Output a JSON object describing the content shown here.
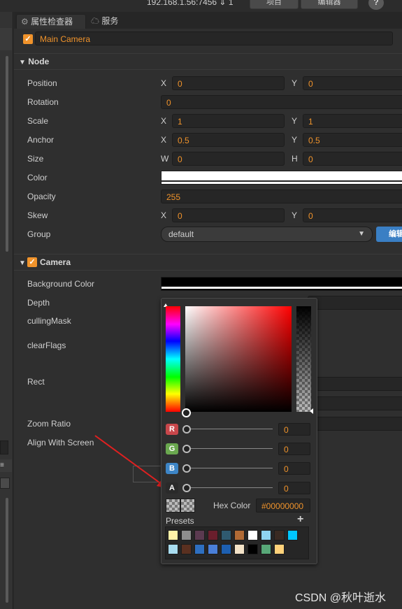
{
  "topbar": {
    "ip": "192.168.1.56:7456 ⇓ 1",
    "btn1": "项目",
    "btn2": "编辑器",
    "help": "?"
  },
  "tabs": [
    {
      "label": "属性检查器"
    },
    {
      "label": "服务"
    }
  ],
  "node_name": "Main Camera",
  "sections": {
    "node": "Node",
    "camera": "Camera"
  },
  "node_props": {
    "position": {
      "label": "Position",
      "x": "0",
      "y": "0"
    },
    "rotation": {
      "label": "Rotation",
      "value": "0"
    },
    "scale": {
      "label": "Scale",
      "x": "1",
      "y": "1"
    },
    "anchor": {
      "label": "Anchor",
      "x": "0.5",
      "y": "0.5"
    },
    "size": {
      "label": "Size",
      "w": "0",
      "h": "0"
    },
    "color": {
      "label": "Color",
      "value": "#ffffff"
    },
    "opacity": {
      "label": "Opacity",
      "value": "255"
    },
    "skew": {
      "label": "Skew",
      "x": "0",
      "y": "0"
    },
    "group": {
      "label": "Group",
      "value": "default",
      "edit": "编辑"
    }
  },
  "axes": {
    "x": "X",
    "y": "Y",
    "w": "W",
    "h": "H"
  },
  "camera_props": {
    "background_color": {
      "label": "Background Color",
      "value": "#000000"
    },
    "depth": "Depth",
    "culling_mask": "cullingMask",
    "clear_flags": "clearFlags",
    "rect": "Rect",
    "zoom_ratio": "Zoom Ratio",
    "align_with_screen": "Align With Screen"
  },
  "color_picker": {
    "channels": [
      {
        "letter": "R",
        "value": "0",
        "color": "#c8474b"
      },
      {
        "letter": "G",
        "value": "0",
        "color": "#6aa84f"
      },
      {
        "letter": "B",
        "value": "0",
        "color": "#3d85c6"
      },
      {
        "letter": "A",
        "value": "0",
        "color": "#2a2a2a"
      }
    ],
    "hex_label": "Hex Color",
    "hex_value": "#00000000",
    "presets_label": "Presets",
    "add": "+",
    "presets_row1": [
      "#fff2a8",
      "#8e8e8e",
      "#5b3a50",
      "#6a1e2c",
      "#2f5a70",
      "#b06a35",
      "#ffffff",
      "#8fd3f0",
      "#3a2a22",
      "#00c6ff"
    ],
    "presets_row2": [
      "#a8dcef",
      "#5a3020",
      "#2e6fc0",
      "#4a7fd8",
      "#1d5fb0",
      "#f3e3c8",
      "#000000",
      "#58a878",
      "#ffd27a"
    ]
  },
  "watermark": "CSDN @秋叶逝水"
}
